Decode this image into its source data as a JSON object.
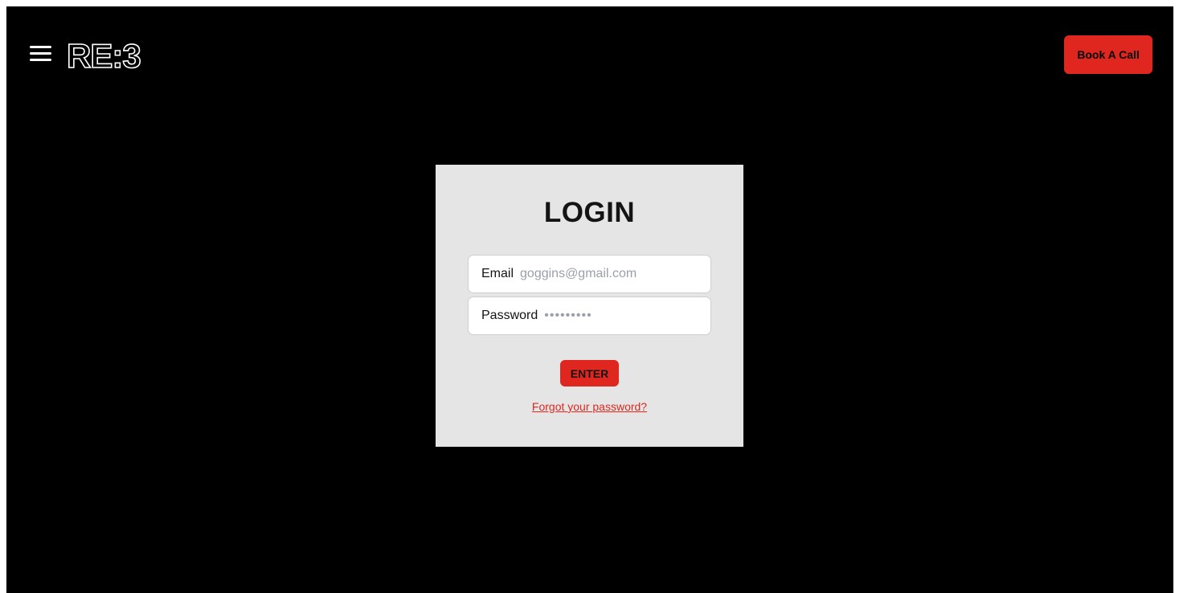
{
  "header": {
    "menu_icon": "hamburger-menu-icon",
    "logo_text": "RE:3",
    "book_button_label": "Book A Call"
  },
  "login": {
    "title": "LOGIN",
    "email_label": "Email",
    "email_placeholder": "goggins@gmail.com",
    "email_value": "",
    "password_label": "Password",
    "password_placeholder": "•••••••••",
    "password_value": "",
    "enter_button_label": "ENTER",
    "forgot_link_text": "Forgot your password?"
  },
  "colors": {
    "background": "#000000",
    "accent": "#e0271f",
    "card": "#e5e5e5"
  }
}
